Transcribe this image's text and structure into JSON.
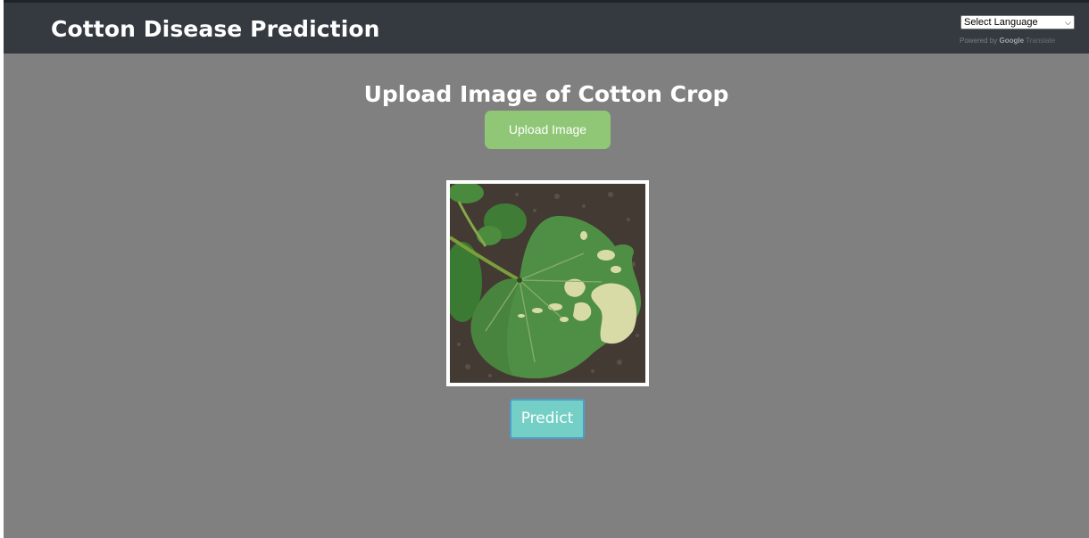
{
  "navbar": {
    "brand": "Cotton Disease Prediction",
    "language_select": {
      "value": "Select Language",
      "powered_by": "Powered by",
      "google": "Google",
      "translate": "Translate"
    }
  },
  "main": {
    "heading": "Upload Image of Cotton Crop",
    "upload_label": "Upload Image",
    "preview_alt": "cotton leaf with disease spots",
    "predict_label": "Predict"
  },
  "colors": {
    "navbar": "#343a40",
    "background": "#808080",
    "upload_button": "#8fc776",
    "predict_button": "#74cfc6",
    "predict_border": "#4f9ec9"
  },
  "icons": {
    "dropdown": "chevron-down-icon"
  }
}
